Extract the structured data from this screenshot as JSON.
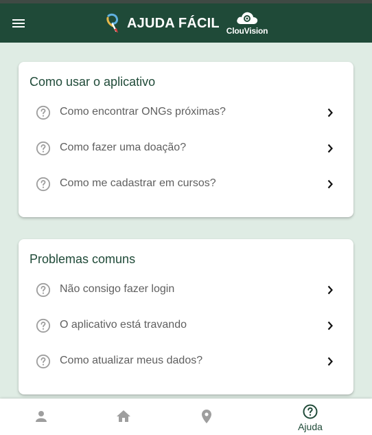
{
  "colors": {
    "appbar": "#1f4a38",
    "background": "#dfece4",
    "accent": "#1f4a38",
    "icon_grey": "#9e9e9e",
    "text_grey": "#5f5f5f"
  },
  "appbar": {
    "menu_icon": "menu-icon",
    "title": "AJUDA FÁCIL",
    "partner_name": "ClouVision"
  },
  "sections": [
    {
      "title": "Como usar o aplicativo",
      "items": [
        {
          "label": "Como encontrar ONGs próximas?",
          "icon": "help-circle-icon"
        },
        {
          "label": "Como fazer uma doação?",
          "icon": "help-circle-icon"
        },
        {
          "label": "Como me cadastrar em cursos?",
          "icon": "help-circle-icon"
        }
      ]
    },
    {
      "title": "Problemas comuns",
      "items": [
        {
          "label": "Não consigo fazer login",
          "icon": "help-circle-icon"
        },
        {
          "label": "O aplicativo está travando",
          "icon": "help-circle-icon"
        },
        {
          "label": "Como atualizar meus dados?",
          "icon": "help-circle-icon"
        }
      ]
    }
  ],
  "bottom_nav": {
    "items": [
      {
        "icon": "person-icon",
        "label": "",
        "active": false
      },
      {
        "icon": "home-icon",
        "label": "",
        "active": false
      },
      {
        "icon": "location-pin-icon",
        "label": "",
        "active": false
      },
      {
        "icon": "help-circle-icon",
        "label": "Ajuda",
        "active": true
      }
    ]
  }
}
